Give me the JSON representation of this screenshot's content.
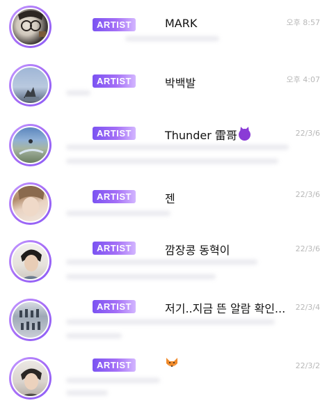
{
  "badge_label": "ARTIST",
  "conversations": [
    {
      "name": "MARK",
      "time": "오후 8:57"
    },
    {
      "name": "박백발",
      "time": "오후 4:07"
    },
    {
      "name": "Thunder 雷哥",
      "emoji": "smiling-devil-emoji",
      "time": "22/3/6"
    },
    {
      "name": "젠",
      "time": "22/3/6"
    },
    {
      "name": "깜장콩 동혁이",
      "time": "22/3/6"
    },
    {
      "name": "저기..지금 뜬 알람 확인...",
      "time": "22/3/4"
    },
    {
      "name": "",
      "emoji": "fox-emoji",
      "time": "22/3/2"
    }
  ],
  "colors": {
    "badge_start": "#7b53f2",
    "badge_end": "#d3b6ff",
    "avatar_ring": "#a56cf6",
    "time_text": "#b8b8b8"
  }
}
